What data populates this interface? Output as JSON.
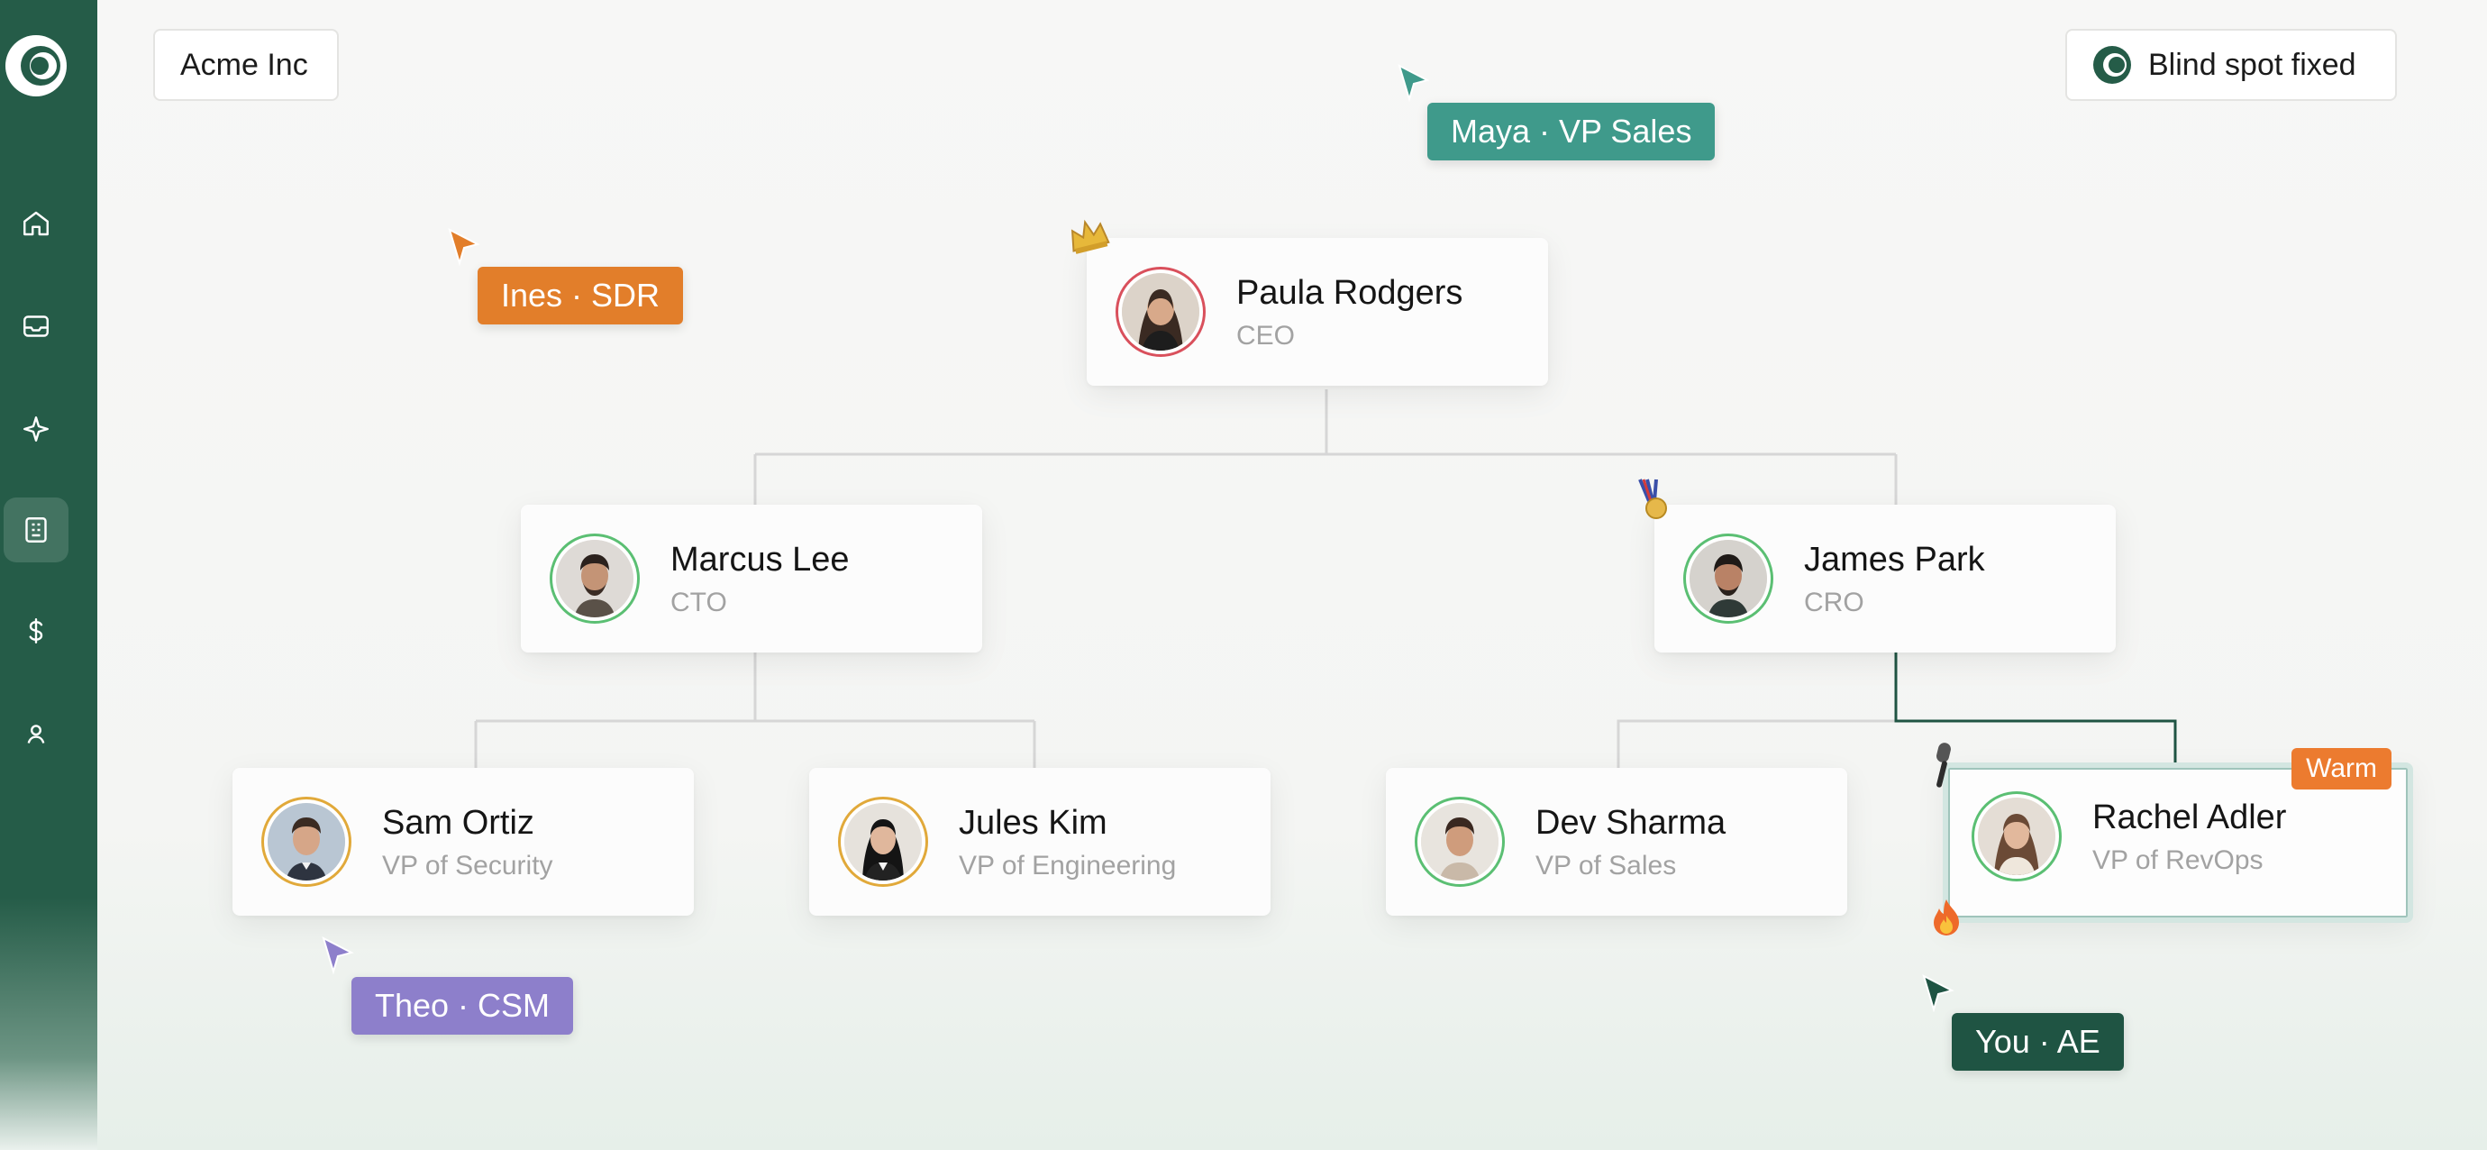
{
  "app": {
    "company": "Acme Inc",
    "status": "Blind spot fixed"
  },
  "sidebar": {
    "items": [
      {
        "icon": "home-icon"
      },
      {
        "icon": "inbox-icon"
      },
      {
        "icon": "sparkle-icon"
      },
      {
        "icon": "org-chart-icon",
        "active": true
      },
      {
        "icon": "dollar-icon"
      },
      {
        "icon": "user-icon"
      }
    ]
  },
  "org": {
    "ceo": {
      "name": "Paula Rodgers",
      "title": "CEO"
    },
    "cto": {
      "name": "Marcus Lee",
      "title": "CTO"
    },
    "cro": {
      "name": "James Park",
      "title": "CRO"
    },
    "vp_security": {
      "name": "Sam Ortiz",
      "title": "VP of Security"
    },
    "vp_engineering": {
      "name": "Jules Kim",
      "title": "VP of Engineering"
    },
    "vp_sales": {
      "name": "Dev Sharma",
      "title": "VP of Sales"
    },
    "vp_revops": {
      "name": "Rachel Adler",
      "title": "VP of RevOps",
      "badge": "Warm"
    }
  },
  "cursors": {
    "maya": {
      "name": "Maya",
      "role": "VP Sales",
      "label": "Maya · VP Sales",
      "color": "#3f9a8b"
    },
    "ines": {
      "name": "Ines",
      "role": "SDR",
      "label": "Ines · SDR",
      "color": "#e27e2a"
    },
    "theo": {
      "name": "Theo",
      "role": "CSM",
      "label": "Theo · CSM",
      "color": "#8d7fcb"
    },
    "you": {
      "name": "You",
      "role": "AE",
      "label": "You · AE",
      "color": "#1f5443"
    }
  },
  "colors": {
    "brand": "#255c48",
    "warm_badge": "#ec7b2f",
    "ring_green": "#5bbf73",
    "ring_red": "#d9505c",
    "ring_gold": "#e1a93a",
    "active_path": "#1f5443"
  }
}
